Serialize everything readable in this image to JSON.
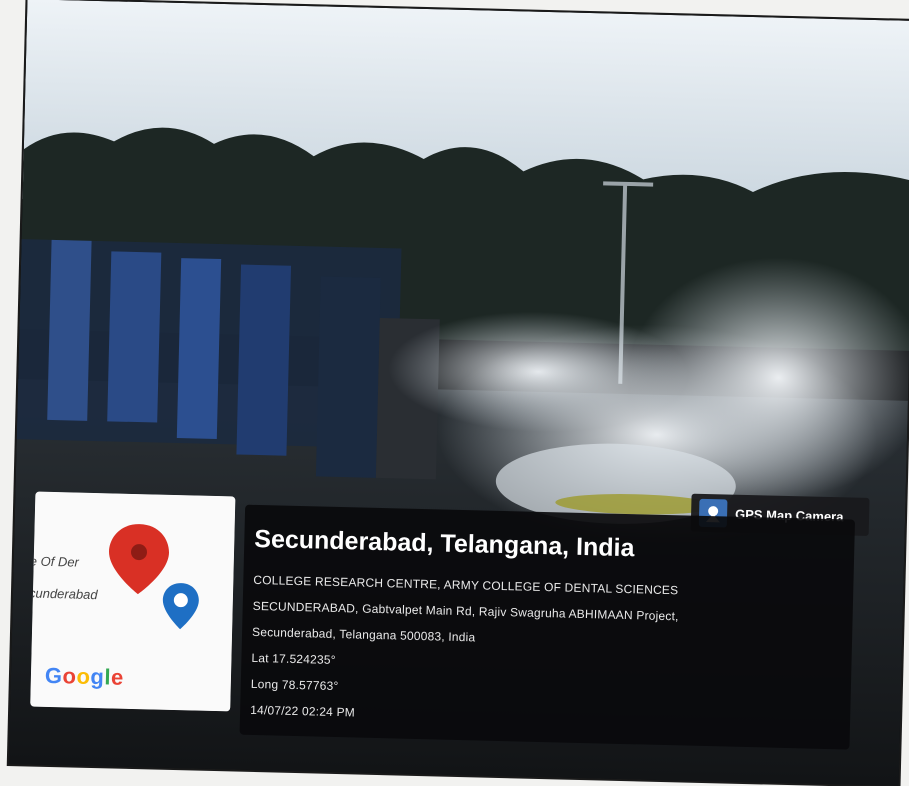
{
  "badge": {
    "label": "GPS Map Camera",
    "icon": "camera-map-icon"
  },
  "map": {
    "place_line1": "e Of Der",
    "place_line2": "cunderabad",
    "logo_text": "Google",
    "logo_colors": [
      "#4285F4",
      "#EA4335",
      "#FBBC05",
      "#4285F4",
      "#34A853",
      "#EA4335"
    ]
  },
  "caption": {
    "title": "Secunderabad, Telangana, India",
    "address_line1": "COLLEGE RESEARCH CENTRE, ARMY COLLEGE OF DENTAL SCIENCES",
    "address_line2": "SECUNDERABAD, Gabtvalpet Main Rd, Rajiv Swagruha ABHIMAAN Project,",
    "address_line3": "Secunderabad, Telangana 500083, India",
    "lat": "Lat 17.524235°",
    "long": "Long 78.57763°",
    "datetime": "14/07/22 02:24 PM"
  }
}
